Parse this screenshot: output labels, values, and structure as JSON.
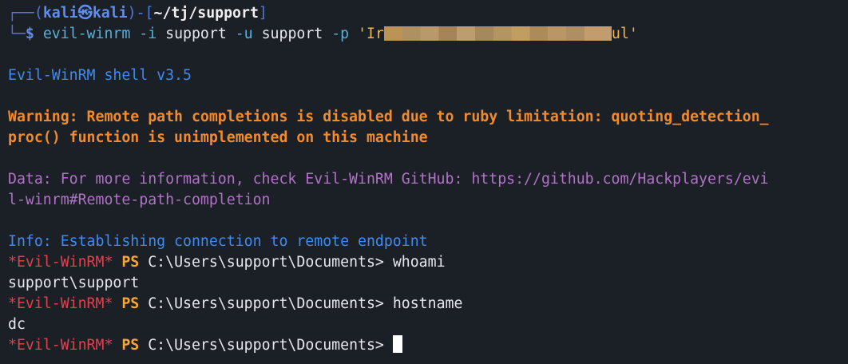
{
  "prompt": {
    "frame_top_left": "┌──(",
    "user": "kali",
    "at_symbol": "㉿",
    "host": "kali",
    "frame_mid": ")-[",
    "cwd": "~/tj/support",
    "frame_top_right": "]",
    "frame_bottom": "└─",
    "dollar": "$ "
  },
  "command": {
    "program": "evil-winrm",
    "flag_i": " -i ",
    "host_arg": "support",
    "flag_u": " -u ",
    "user_arg": "support",
    "flag_p": " -p ",
    "password_start": "'Ir",
    "password_end": "ul'"
  },
  "output": {
    "banner": "Evil-WinRM shell v3.5",
    "warning_line1": "Warning: Remote path completions is disabled due to ruby limitation: quoting_detection_",
    "warning_line2": "proc() function is unimplemented on this machine",
    "data_line1": "Data: For more information, check Evil-WinRM GitHub: https://github.com/Hackplayers/evi",
    "data_line2": "l-winrm#Remote-path-completion",
    "info": "Info: Establishing connection to remote endpoint"
  },
  "session": {
    "ps_tag": "*Evil-WinRM*",
    "ps_label": " PS ",
    "ps_path": "C:\\Users\\support\\Documents> ",
    "commands": [
      {
        "input": "whoami",
        "output": "support\\support"
      },
      {
        "input": "hostname",
        "output": "dc"
      },
      {
        "input": "",
        "output": ""
      }
    ]
  },
  "colors": {
    "background": "#1b1f26",
    "prompt_frame": "#4c79e0",
    "command": "#56b0d9",
    "string": "#f0b64a",
    "info_blue": "#3d8cf2",
    "warning_orange": "#f28b2c",
    "data_purple": "#b173c6",
    "evil_red": "#e0414e",
    "ps_orange": "#f7a733"
  }
}
